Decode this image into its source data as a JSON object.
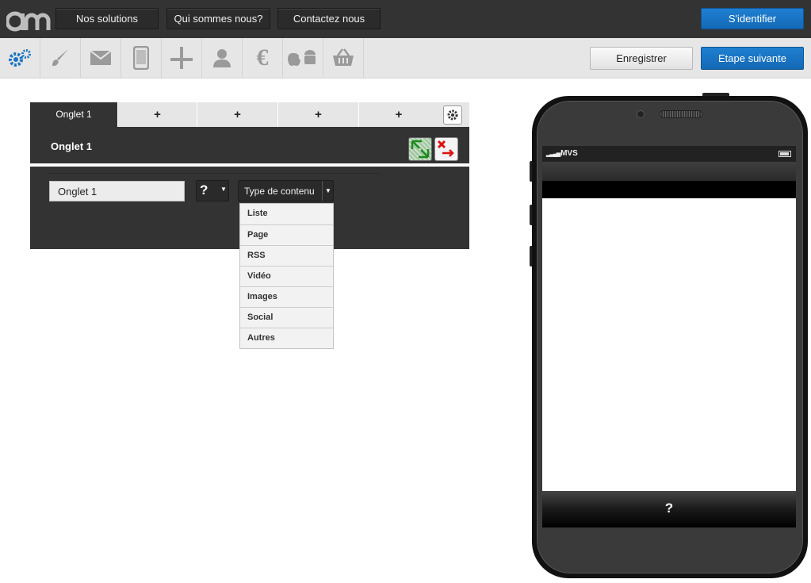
{
  "header": {
    "nav": [
      "Nos solutions",
      "Qui sommes nous?",
      "Contactez nous"
    ],
    "login_label": "S'identifier"
  },
  "toolbar": {
    "tools": [
      "settings-gears-icon",
      "brush-icon",
      "mail-icon",
      "smartphone-icon",
      "layout-icon",
      "user-icon",
      "euro-icon",
      "apple-android-icon",
      "basket-icon"
    ],
    "save_label": "Enregistrer",
    "next_label": "Etape suivante",
    "accent": "#1a73c5"
  },
  "editor": {
    "tabs": [
      {
        "label": "Onglet 1",
        "active": true
      },
      {
        "label": "+"
      },
      {
        "label": "+"
      },
      {
        "label": "+"
      },
      {
        "label": "+"
      }
    ],
    "panel_title": "Onglet 1",
    "tab_name_value": "Onglet 1",
    "icon_placeholder": "?",
    "content_type_label": "Type de contenu",
    "content_types": [
      "Liste",
      "Page",
      "RSS",
      "Vidéo",
      "Images",
      "Social",
      "Autres"
    ]
  },
  "phone": {
    "carrier": "MVS",
    "tab_icon": "?"
  }
}
